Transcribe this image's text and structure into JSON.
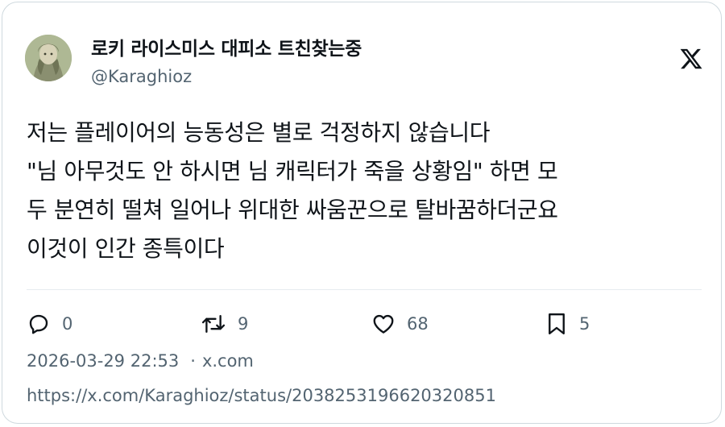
{
  "author": {
    "display_name": "로키 라이스미스 대피소 트친찾는중",
    "handle": "@Karaghioz",
    "avatar": "avatar-image"
  },
  "header": {
    "logo_icon": "x-logo-icon"
  },
  "tweet": {
    "lines": [
      "저는 플레이어의 능동성은 별로 걱정하지 않습니다",
      "\"님 아무것도 안 하시면 님 캐릭터가 죽을 상황임\" 하면 모",
      "두 분연히 떨쳐 일어나 위대한 싸움꾼으로 탈바꿈하더군요",
      "이것이 인간 종특이다"
    ]
  },
  "actions": {
    "reply": {
      "icon": "reply-icon",
      "count": "0"
    },
    "retweet": {
      "icon": "retweet-icon",
      "count": "9"
    },
    "like": {
      "icon": "heart-icon",
      "count": "68"
    },
    "bookmark": {
      "icon": "bookmark-icon",
      "count": "5"
    }
  },
  "meta": {
    "timestamp": "2026-03-29 22:53",
    "separator": "·",
    "source": "x.com"
  },
  "url": "https://x.com/Karaghioz/status/2038253196620320851",
  "colors": {
    "text": "#0f1419",
    "secondary": "#536471",
    "border": "#cfd9de"
  }
}
